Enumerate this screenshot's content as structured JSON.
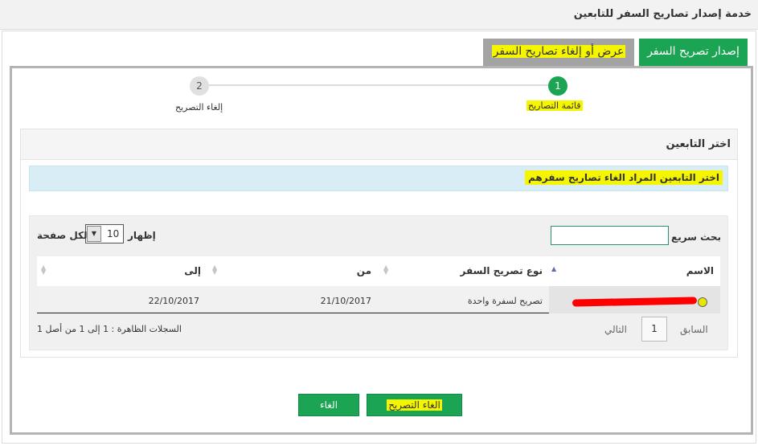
{
  "header": {
    "title": "خدمة إصدار تصاريح السفر للتابعين"
  },
  "tabs": [
    {
      "label": "إصدار تصريح السفر"
    },
    {
      "label": "عرض أو إلغاء تصاريح السفر"
    }
  ],
  "wizard": {
    "steps": [
      {
        "number": "1",
        "label": "قائمة التصاريح"
      },
      {
        "number": "2",
        "label": "إلغاء التصريح"
      }
    ]
  },
  "panel": {
    "title": "اختر التابعين",
    "info": "اختر التابعين المراد الغاء تصاريح سفرهم"
  },
  "table": {
    "search_label": "بحث سريع :",
    "search_value": "",
    "show_label": "إظهار",
    "per_page_value": "10",
    "per_page_label": "لكل صفحة",
    "columns": [
      "الاسم",
      "نوع تصريح السفر",
      "من",
      "إلى"
    ],
    "rows": [
      {
        "type": "تصريح لسفرة واحدة",
        "from": "21/10/2017",
        "to": "22/10/2017"
      }
    ],
    "pagination": {
      "prev": "السابق",
      "page": "1",
      "next": "التالي"
    },
    "records_info": "السجلات الظاهرة : 1 إلى 1 من أصل 1"
  },
  "buttons": {
    "cancel_permit": "الغاء التصريح",
    "cancel": "الغاء"
  },
  "colors": {
    "primary_green": "#1ba453",
    "highlight_yellow": "#f5f500",
    "info_bg": "#d8edf5",
    "redaction_red": "#ff0000"
  }
}
